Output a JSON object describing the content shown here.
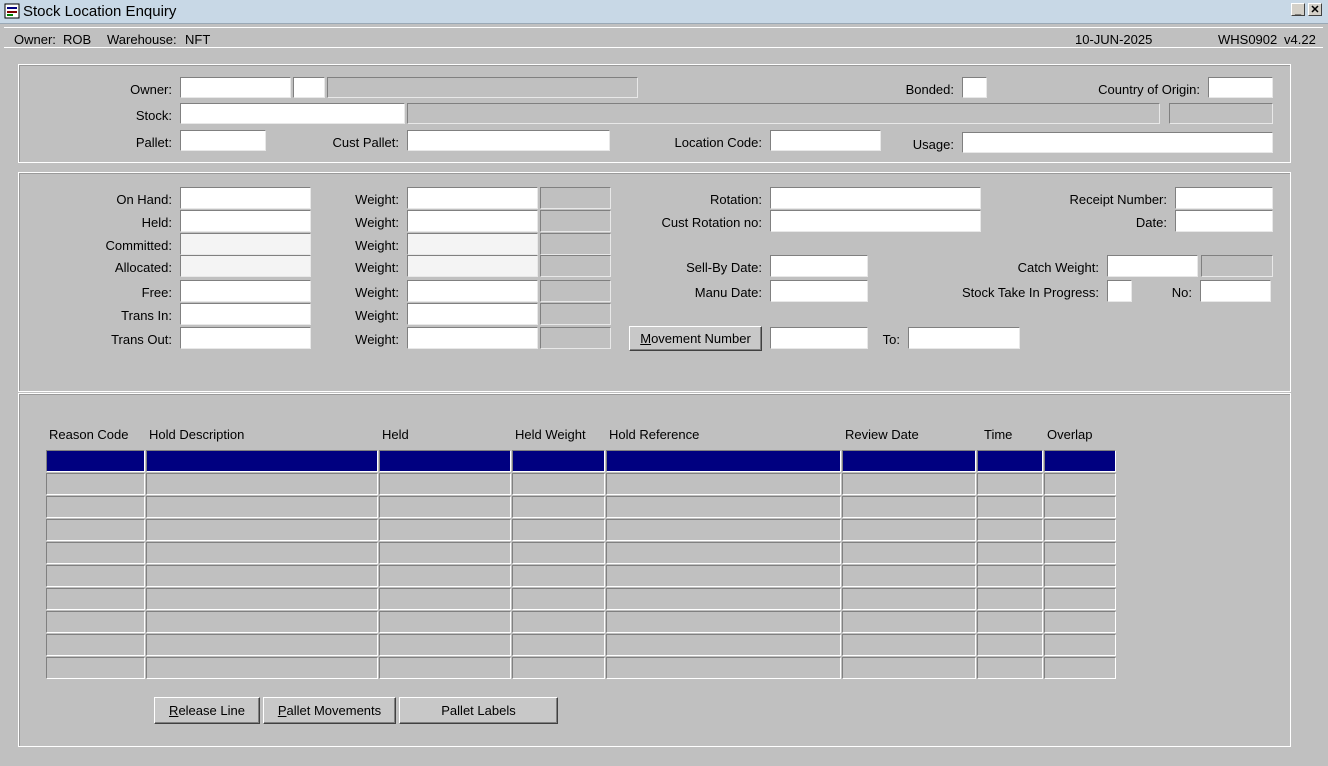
{
  "window": {
    "title": "Stock Location Enquiry"
  },
  "status": {
    "owner_label": "Owner:",
    "owner": "ROB",
    "warehouse_label": "Warehouse:",
    "warehouse": "NFT",
    "date": "10-JUN-2025",
    "program": "WHS0902",
    "version": "v4.22"
  },
  "header_form": {
    "owner_label": "Owner:",
    "stock_label": "Stock:",
    "pallet_label": "Pallet:",
    "cust_pallet_label": "Cust Pallet:",
    "location_code_label": "Location Code:",
    "usage_label": "Usage:",
    "bonded_label": "Bonded:",
    "country_label": "Country of Origin:"
  },
  "qty_form": {
    "on_hand_label": "On Hand:",
    "held_label": "Held:",
    "committed_label": "Committed:",
    "allocated_label": "Allocated:",
    "free_label": "Free:",
    "trans_in_label": "Trans In:",
    "trans_out_label": "Trans Out:",
    "weight_label": "Weight:",
    "rotation_label": "Rotation:",
    "cust_rotation_label": "Cust Rotation no:",
    "sell_by_label": "Sell-By Date:",
    "manu_date_label": "Manu Date:",
    "receipt_label": "Receipt Number:",
    "date_label": "Date:",
    "catch_weight_label": "Catch Weight:",
    "stock_take_label": "Stock Take In Progress:",
    "no_label": "No:",
    "movement_mnemonic": "M",
    "movement_rest": "ovement Number",
    "to_label": "To:"
  },
  "grid": {
    "columns": [
      "Reason Code",
      "Hold Description",
      "Held",
      "Held Weight",
      "Hold Reference",
      "Review Date",
      "Time",
      "Overlap"
    ],
    "row_count": 10,
    "selected_row": 0
  },
  "buttons": {
    "release_mnemonic": "R",
    "release_rest": "elease Line",
    "pallet_moves_mnemonic": "P",
    "pallet_moves_rest": "allet Movements",
    "pallet_labels": "Pallet Labels"
  },
  "colors": {
    "selected_row": "#000080",
    "background": "#c0c0c0",
    "titlebar": "#c8d8e6"
  }
}
